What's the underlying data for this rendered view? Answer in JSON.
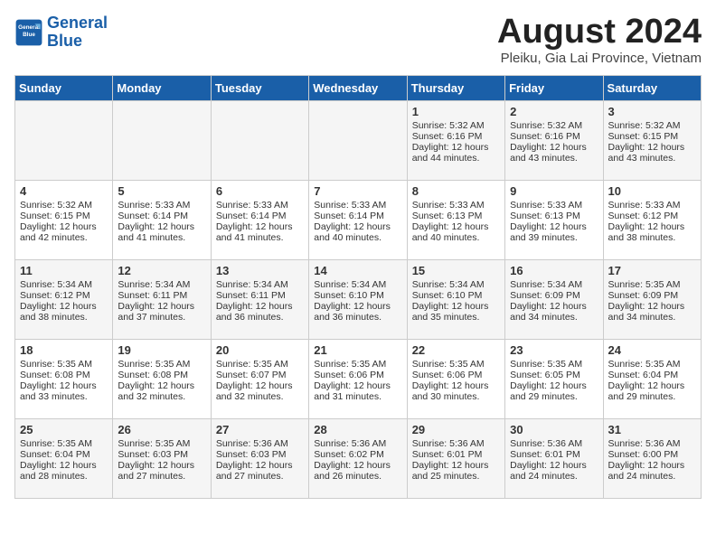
{
  "logo": {
    "line1": "General",
    "line2": "Blue"
  },
  "calendar": {
    "title": "August 2024",
    "subtitle": "Pleiku, Gia Lai Province, Vietnam"
  },
  "weekdays": [
    "Sunday",
    "Monday",
    "Tuesday",
    "Wednesday",
    "Thursday",
    "Friday",
    "Saturday"
  ],
  "weeks": [
    [
      {
        "day": "",
        "sunrise": "",
        "sunset": "",
        "daylight": "",
        "empty": true
      },
      {
        "day": "",
        "sunrise": "",
        "sunset": "",
        "daylight": "",
        "empty": true
      },
      {
        "day": "",
        "sunrise": "",
        "sunset": "",
        "daylight": "",
        "empty": true
      },
      {
        "day": "",
        "sunrise": "",
        "sunset": "",
        "daylight": "",
        "empty": true
      },
      {
        "day": "1",
        "sunrise": "Sunrise: 5:32 AM",
        "sunset": "Sunset: 6:16 PM",
        "daylight": "Daylight: 12 hours and 44 minutes."
      },
      {
        "day": "2",
        "sunrise": "Sunrise: 5:32 AM",
        "sunset": "Sunset: 6:16 PM",
        "daylight": "Daylight: 12 hours and 43 minutes."
      },
      {
        "day": "3",
        "sunrise": "Sunrise: 5:32 AM",
        "sunset": "Sunset: 6:15 PM",
        "daylight": "Daylight: 12 hours and 43 minutes."
      }
    ],
    [
      {
        "day": "4",
        "sunrise": "Sunrise: 5:32 AM",
        "sunset": "Sunset: 6:15 PM",
        "daylight": "Daylight: 12 hours and 42 minutes."
      },
      {
        "day": "5",
        "sunrise": "Sunrise: 5:33 AM",
        "sunset": "Sunset: 6:14 PM",
        "daylight": "Daylight: 12 hours and 41 minutes."
      },
      {
        "day": "6",
        "sunrise": "Sunrise: 5:33 AM",
        "sunset": "Sunset: 6:14 PM",
        "daylight": "Daylight: 12 hours and 41 minutes."
      },
      {
        "day": "7",
        "sunrise": "Sunrise: 5:33 AM",
        "sunset": "Sunset: 6:14 PM",
        "daylight": "Daylight: 12 hours and 40 minutes."
      },
      {
        "day": "8",
        "sunrise": "Sunrise: 5:33 AM",
        "sunset": "Sunset: 6:13 PM",
        "daylight": "Daylight: 12 hours and 40 minutes."
      },
      {
        "day": "9",
        "sunrise": "Sunrise: 5:33 AM",
        "sunset": "Sunset: 6:13 PM",
        "daylight": "Daylight: 12 hours and 39 minutes."
      },
      {
        "day": "10",
        "sunrise": "Sunrise: 5:33 AM",
        "sunset": "Sunset: 6:12 PM",
        "daylight": "Daylight: 12 hours and 38 minutes."
      }
    ],
    [
      {
        "day": "11",
        "sunrise": "Sunrise: 5:34 AM",
        "sunset": "Sunset: 6:12 PM",
        "daylight": "Daylight: 12 hours and 38 minutes."
      },
      {
        "day": "12",
        "sunrise": "Sunrise: 5:34 AM",
        "sunset": "Sunset: 6:11 PM",
        "daylight": "Daylight: 12 hours and 37 minutes."
      },
      {
        "day": "13",
        "sunrise": "Sunrise: 5:34 AM",
        "sunset": "Sunset: 6:11 PM",
        "daylight": "Daylight: 12 hours and 36 minutes."
      },
      {
        "day": "14",
        "sunrise": "Sunrise: 5:34 AM",
        "sunset": "Sunset: 6:10 PM",
        "daylight": "Daylight: 12 hours and 36 minutes."
      },
      {
        "day": "15",
        "sunrise": "Sunrise: 5:34 AM",
        "sunset": "Sunset: 6:10 PM",
        "daylight": "Daylight: 12 hours and 35 minutes."
      },
      {
        "day": "16",
        "sunrise": "Sunrise: 5:34 AM",
        "sunset": "Sunset: 6:09 PM",
        "daylight": "Daylight: 12 hours and 34 minutes."
      },
      {
        "day": "17",
        "sunrise": "Sunrise: 5:35 AM",
        "sunset": "Sunset: 6:09 PM",
        "daylight": "Daylight: 12 hours and 34 minutes."
      }
    ],
    [
      {
        "day": "18",
        "sunrise": "Sunrise: 5:35 AM",
        "sunset": "Sunset: 6:08 PM",
        "daylight": "Daylight: 12 hours and 33 minutes."
      },
      {
        "day": "19",
        "sunrise": "Sunrise: 5:35 AM",
        "sunset": "Sunset: 6:08 PM",
        "daylight": "Daylight: 12 hours and 32 minutes."
      },
      {
        "day": "20",
        "sunrise": "Sunrise: 5:35 AM",
        "sunset": "Sunset: 6:07 PM",
        "daylight": "Daylight: 12 hours and 32 minutes."
      },
      {
        "day": "21",
        "sunrise": "Sunrise: 5:35 AM",
        "sunset": "Sunset: 6:06 PM",
        "daylight": "Daylight: 12 hours and 31 minutes."
      },
      {
        "day": "22",
        "sunrise": "Sunrise: 5:35 AM",
        "sunset": "Sunset: 6:06 PM",
        "daylight": "Daylight: 12 hours and 30 minutes."
      },
      {
        "day": "23",
        "sunrise": "Sunrise: 5:35 AM",
        "sunset": "Sunset: 6:05 PM",
        "daylight": "Daylight: 12 hours and 29 minutes."
      },
      {
        "day": "24",
        "sunrise": "Sunrise: 5:35 AM",
        "sunset": "Sunset: 6:04 PM",
        "daylight": "Daylight: 12 hours and 29 minutes."
      }
    ],
    [
      {
        "day": "25",
        "sunrise": "Sunrise: 5:35 AM",
        "sunset": "Sunset: 6:04 PM",
        "daylight": "Daylight: 12 hours and 28 minutes."
      },
      {
        "day": "26",
        "sunrise": "Sunrise: 5:35 AM",
        "sunset": "Sunset: 6:03 PM",
        "daylight": "Daylight: 12 hours and 27 minutes."
      },
      {
        "day": "27",
        "sunrise": "Sunrise: 5:36 AM",
        "sunset": "Sunset: 6:03 PM",
        "daylight": "Daylight: 12 hours and 27 minutes."
      },
      {
        "day": "28",
        "sunrise": "Sunrise: 5:36 AM",
        "sunset": "Sunset: 6:02 PM",
        "daylight": "Daylight: 12 hours and 26 minutes."
      },
      {
        "day": "29",
        "sunrise": "Sunrise: 5:36 AM",
        "sunset": "Sunset: 6:01 PM",
        "daylight": "Daylight: 12 hours and 25 minutes."
      },
      {
        "day": "30",
        "sunrise": "Sunrise: 5:36 AM",
        "sunset": "Sunset: 6:01 PM",
        "daylight": "Daylight: 12 hours and 24 minutes."
      },
      {
        "day": "31",
        "sunrise": "Sunrise: 5:36 AM",
        "sunset": "Sunset: 6:00 PM",
        "daylight": "Daylight: 12 hours and 24 minutes."
      }
    ]
  ]
}
